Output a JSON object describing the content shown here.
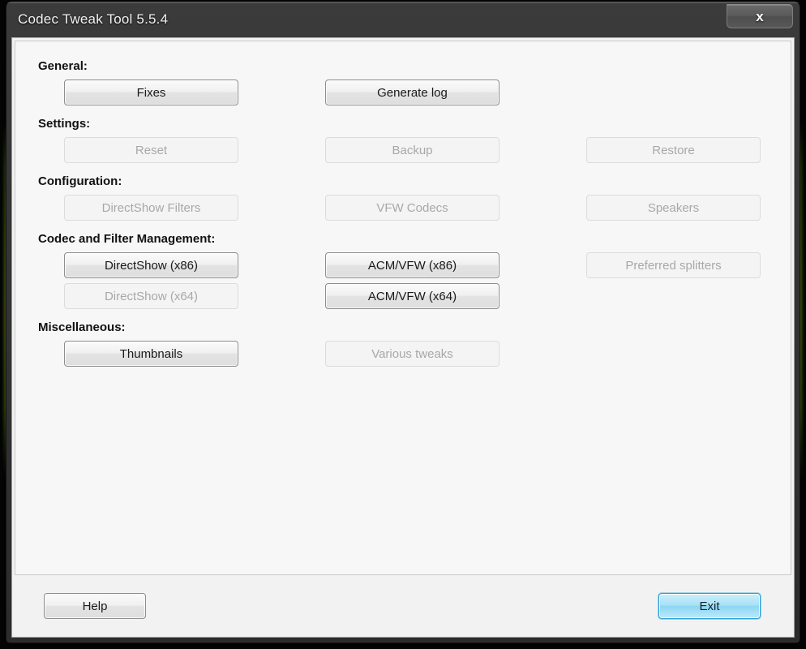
{
  "window": {
    "title": "Codec Tweak Tool 5.5.4",
    "close_label": "×",
    "close_glyph": "x"
  },
  "colors": {
    "accent_primary": "#8ed6f3",
    "primary_border": "#2a9fd4",
    "desktop_glow": "#8fcc15",
    "enabled_text": "#1a1a1a",
    "disabled_text": "#a8a8a8",
    "titlebar": "#343434"
  },
  "sections": [
    {
      "heading": "General:",
      "rows": [
        [
          {
            "label": "Fixes",
            "enabled": true,
            "name": "fixes-button"
          },
          {
            "label": "Generate log",
            "enabled": true,
            "name": "generate-log-button"
          },
          null
        ]
      ]
    },
    {
      "heading": "Settings:",
      "rows": [
        [
          {
            "label": "Reset",
            "enabled": false,
            "name": "reset-button"
          },
          {
            "label": "Backup",
            "enabled": false,
            "name": "backup-button"
          },
          {
            "label": "Restore",
            "enabled": false,
            "name": "restore-button"
          }
        ]
      ]
    },
    {
      "heading": "Configuration:",
      "rows": [
        [
          {
            "label": "DirectShow Filters",
            "enabled": false,
            "name": "directshow-filters-button"
          },
          {
            "label": "VFW Codecs",
            "enabled": false,
            "name": "vfw-codecs-button"
          },
          {
            "label": "Speakers",
            "enabled": false,
            "name": "speakers-button"
          }
        ]
      ]
    },
    {
      "heading": "Codec and Filter Management:",
      "rows": [
        [
          {
            "label": "DirectShow  (x86)",
            "enabled": true,
            "name": "directshow-x86-button"
          },
          {
            "label": "ACM/VFW  (x86)",
            "enabled": true,
            "name": "acm-vfw-x86-button"
          },
          {
            "label": "Preferred splitters",
            "enabled": false,
            "name": "preferred-splitters-button"
          }
        ],
        [
          {
            "label": "DirectShow  (x64)",
            "enabled": false,
            "name": "directshow-x64-button"
          },
          {
            "label": "ACM/VFW  (x64)",
            "enabled": true,
            "name": "acm-vfw-x64-button"
          },
          null
        ]
      ]
    },
    {
      "heading": "Miscellaneous:",
      "rows": [
        [
          {
            "label": "Thumbnails",
            "enabled": true,
            "name": "thumbnails-button"
          },
          {
            "label": "Various tweaks",
            "enabled": false,
            "name": "various-tweaks-button"
          },
          null
        ]
      ]
    }
  ],
  "footer": {
    "help_label": "Help",
    "exit_label": "Exit"
  }
}
